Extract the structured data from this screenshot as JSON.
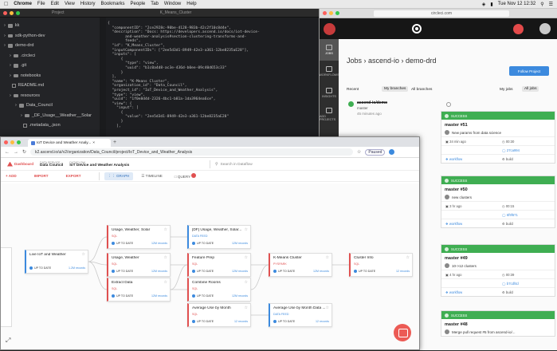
{
  "menubar": {
    "app": "Chrome",
    "items": [
      "File",
      "Edit",
      "View",
      "History",
      "Bookmarks",
      "People",
      "Tab",
      "Window",
      "Help"
    ],
    "clock": "Tue Nov 12 12:32"
  },
  "editor": {
    "panel_title": "Project",
    "file_title": "K_Means_Cluster",
    "tree": [
      {
        "label": "kk",
        "kind": "folder",
        "indent": 1
      },
      {
        "label": "sdk-python-dev",
        "kind": "folder",
        "indent": 1
      },
      {
        "label": "demo-drd",
        "kind": "folder",
        "indent": 1
      },
      {
        "label": ".circleci",
        "kind": "folder",
        "indent": 2
      },
      {
        "label": ".git",
        "kind": "folder",
        "indent": 2
      },
      {
        "label": "notebooks",
        "kind": "folder",
        "indent": 2
      },
      {
        "label": "README.md",
        "kind": "file",
        "indent": 2
      },
      {
        "label": "resources",
        "kind": "folder",
        "indent": 2
      },
      {
        "label": "Data_Council",
        "kind": "folder",
        "indent": 3
      },
      {
        "label": "_DF_Usage__Weather__Solar",
        "kind": "folder",
        "indent": 4
      },
      {
        "label": ".metadata_.json",
        "kind": "file",
        "indent": 4
      }
    ],
    "code": [
      "{",
      "  \"componentID\": \"2ce2928c-90be-4128-983b-42c2f10c8d4e\",",
      "  \"description\": \"Docs: https://developers.ascend.io/docs/iot-device-",
      "        and-weather-analysis#section-clustering-transforms-and-",
      "        feeds\",",
      "  \"id\": \"K_Means_Cluster\",",
      "  \"inputComponentIDs\": [\"2ee5d3d1-8949-42e3-a361-12be8235aE28\"],",
      "  \"inputs\": [",
      "      {",
      "        \"type\": \"view\",",
      "        \"uuid\": \"b1c0a4d8-ac3e-436d-b0ee-09c40d653c33\"",
      "      }",
      "  ],",
      "  \"name\": \"K-Means Cluster\",",
      "  \"organization_id\": \"Data_Council\",",
      "  \"project_id\": \"IoT_Device_and_Weather_Analysis\",",
      "  \"type\": \"view\",",
      "  \"uuid\": \"1f0e8d4d-2326-4bc1-b81a-1da3964ea6ce\",",
      "  \"view\": {",
      "    \"input\": [",
      "      {",
      "        \"value\": \"2ee5d3d1-8949-42e3-a361-12be8235aE28\"",
      "      }",
      "    ],"
    ]
  },
  "circleci": {
    "url": "circleci.com",
    "breadcrumb": "Jobs  ›  ascend-io  ›  demo-drd",
    "follow_button": "Follow Project",
    "nav": [
      {
        "label": "JOBS",
        "active": true
      },
      {
        "label": "WORKFLOWS",
        "active": false
      },
      {
        "label": "INSIGHTS",
        "active": false
      },
      {
        "label": "ADD PROJECTS",
        "active": false
      }
    ],
    "filters": {
      "recent": "Recent",
      "my_branches": "My branches",
      "all_branches": "All branches",
      "my_jobs": "My jobs",
      "all_jobs": "All jobs"
    },
    "recent_item": {
      "name": "ascend-io/demo",
      "branch": "master",
      "ago": "45 minutes ago"
    },
    "jobs": [
      {
        "status": "SUCCESS",
        "title": "master #51",
        "message": "New params from data science",
        "ago": "34 min ago",
        "duration": "00:30",
        "commit": "27ca994",
        "workflow": "workflow",
        "job": "build"
      },
      {
        "status": "SUCCESS",
        "title": "master #50",
        "message": "new clusters",
        "ago": "3 hr ago",
        "duration": "00:15",
        "commit": "6f9f671",
        "workflow": "workflow",
        "job": "build"
      },
      {
        "status": "SUCCESS",
        "title": "master #49",
        "message": "10->12 clusters",
        "ago": "4 hr ago",
        "duration": "00:39",
        "commit": "b7cdf4d",
        "workflow": "workflow",
        "job": "build"
      },
      {
        "status": "SUCCESS",
        "title": "master #48",
        "message": "Merge pull request #5 from ascend-io/...",
        "ago": "",
        "duration": "",
        "commit": "",
        "workflow": "",
        "job": ""
      }
    ]
  },
  "browser": {
    "tab_title": "IoT Device and Weather Analy...",
    "address": "k2.ascend.io/ui/v2/organization/Data_Council/project/IoT_Device_and_Weather_Analysis",
    "paused": "Paused",
    "dashboard": "Dashboard",
    "data_service_label": "DATA SERVICE",
    "data_service": "Data Council",
    "dataflow_label": "DATAFLOW",
    "dataflow": "IoT Device and Weather Analysis",
    "search_placeholder": "Search in Dataflow",
    "actions": {
      "add": "+ ADD",
      "import": "IMPORT",
      "export": "EXPORT"
    },
    "views": {
      "graph": "GRAPH",
      "timeline": "TIMELINE",
      "query": "QUERY"
    }
  },
  "nodes": [
    {
      "id": "n1",
      "name": "Live IoT and Weather",
      "type": "",
      "status": "UP TO DATE",
      "records": "1.2M records",
      "kind": "blue"
    },
    {
      "id": "n2",
      "name": "Usage, Weather, Solar",
      "type": "SQL",
      "status": "UP TO DATE",
      "records": "12M records",
      "kind": "red"
    },
    {
      "id": "n3",
      "name": "Usage, Weather",
      "type": "SQL",
      "status": "UP TO DATE",
      "records": "12M records",
      "kind": "red"
    },
    {
      "id": "n4",
      "name": "Extract Data",
      "type": "SQL",
      "status": "UP TO DATE",
      "records": "12M records",
      "kind": "red"
    },
    {
      "id": "n5",
      "name": "[DF] Usage, Weather, Solar...",
      "type": "DATA FEED",
      "status": "UP TO DATE",
      "records": "12M records",
      "kind": "blue"
    },
    {
      "id": "n6",
      "name": "Feature Prep",
      "type": "SQL",
      "status": "UP TO DATE",
      "records": "12M records",
      "kind": "red"
    },
    {
      "id": "n7",
      "name": "Combine Rooms",
      "type": "SQL",
      "status": "UP TO DATE",
      "records": "12M records",
      "kind": "red"
    },
    {
      "id": "n8",
      "name": "Average Use by Month",
      "type": "SQL",
      "status": "UP TO DATE",
      "records": "12 records",
      "kind": "red"
    },
    {
      "id": "n9",
      "name": "K-Means Cluster",
      "type": "PYSPARK",
      "status": "UP TO DATE",
      "records": "12M records",
      "kind": "red"
    },
    {
      "id": "n10",
      "name": "Average Use by Month Data ...",
      "type": "DATA FEED",
      "status": "UP TO DATE",
      "records": "12 records",
      "kind": "blue"
    },
    {
      "id": "n11",
      "name": "Cluster Info",
      "type": "SQL",
      "status": "UP TO DATE",
      "records": "12 records",
      "kind": "red"
    }
  ],
  "colors": {
    "accent_blue": "#3c8ade",
    "accent_red": "#e05050",
    "success_green": "#3fae52"
  }
}
